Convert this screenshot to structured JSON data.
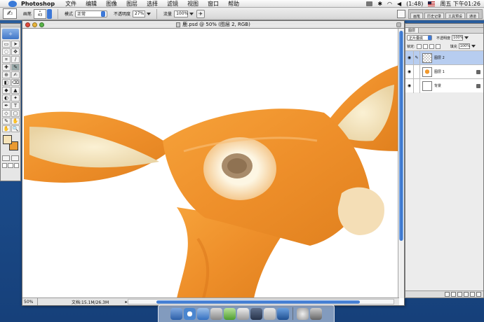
{
  "menubar": {
    "app_name": "Photoshop",
    "menus": [
      "文件",
      "编辑",
      "图像",
      "图层",
      "选择",
      "滤镜",
      "视图",
      "窗口",
      "帮助"
    ],
    "battery": "(1:48)",
    "clock": "周五 下午01:26"
  },
  "options": {
    "brush_label": "画笔",
    "brush_size": "43",
    "mode_label": "模式",
    "mode_value": "正常",
    "opacity_label": "不透明度",
    "opacity_value": "27%",
    "flow_label": "流量",
    "flow_value": "100%",
    "palette_tabs": [
      "画笔",
      "历史记录",
      "工具预设",
      "通道"
    ]
  },
  "tools": {
    "grid": [
      "▭",
      "➤",
      "◌",
      "✥",
      "⌗",
      "∕",
      "✚",
      "✎",
      "⊕",
      "✍",
      "◧",
      "⌫",
      "◆",
      "▲",
      "◐",
      "✦",
      "✒",
      "T",
      "◇",
      "▢",
      "✎",
      "✋",
      "✋",
      "🔍"
    ]
  },
  "document": {
    "title": "鹿.psd @ 50% (图层 2, RGB)",
    "zoom": "50%",
    "info": "文档:15.1M/26.3M"
  },
  "layers": {
    "tabs": [
      "图层"
    ],
    "blend_mode": "正片叠底",
    "opacity_label": "不透明度",
    "opacity_value": "100%",
    "lock_label": "锁定:",
    "fill_label": "填充",
    "fill_value": "100%",
    "items": [
      {
        "name": "图层 2",
        "thumb": "check",
        "active": true,
        "locked": false
      },
      {
        "name": "图层 1",
        "thumb": "deer",
        "active": false,
        "locked": true
      },
      {
        "name": "背景",
        "thumb": "white",
        "active": false,
        "locked": true
      }
    ]
  },
  "colors": {
    "foreground": "#f6e3b8",
    "background": "#e99a33",
    "deer_orange": "#ee9230"
  }
}
